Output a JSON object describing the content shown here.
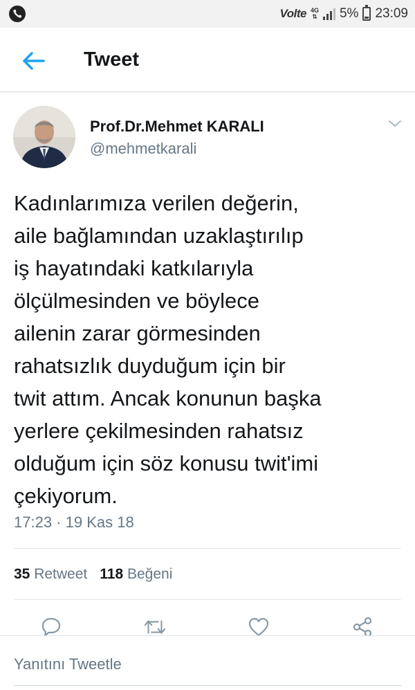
{
  "status_bar": {
    "carrier_icon": "phone-icon",
    "volte": "Volte",
    "network": "4G",
    "battery_percent": "5%",
    "time": "23:09"
  },
  "header": {
    "title": "Tweet",
    "back_icon": "back-arrow-icon"
  },
  "tweet": {
    "author_name": "Prof.Dr.Mehmet KARALI",
    "author_handle": "@mehmetkarali",
    "text": "Kadınlarımıza verilen değerin,\naile bağlamından uzaklaştırılıp\niş hayatındaki katkılarıyla\nölçülmesinden ve böylece\nailenin zarar görmesinden\nrahatsızlık duyduğum için bir\ntwit attım. Ancak konunun başka\nyerlere çekilmesinden rahatsız\nolduğum için söz konusu twit'imi\nçekiyorum.",
    "timestamp": "17:23 · 19 Kas 18"
  },
  "stats": {
    "retweet_count": "35",
    "retweet_label": "Retweet",
    "like_count": "118",
    "like_label": "Beğeni"
  },
  "actions": [
    "reply-icon",
    "retweet-icon",
    "like-icon",
    "share-icon"
  ],
  "reply": {
    "placeholder": "Yanıtını Tweetle"
  },
  "colors": {
    "accent": "#1da1f2",
    "secondary_text": "#657786",
    "primary_text": "#14171a"
  }
}
